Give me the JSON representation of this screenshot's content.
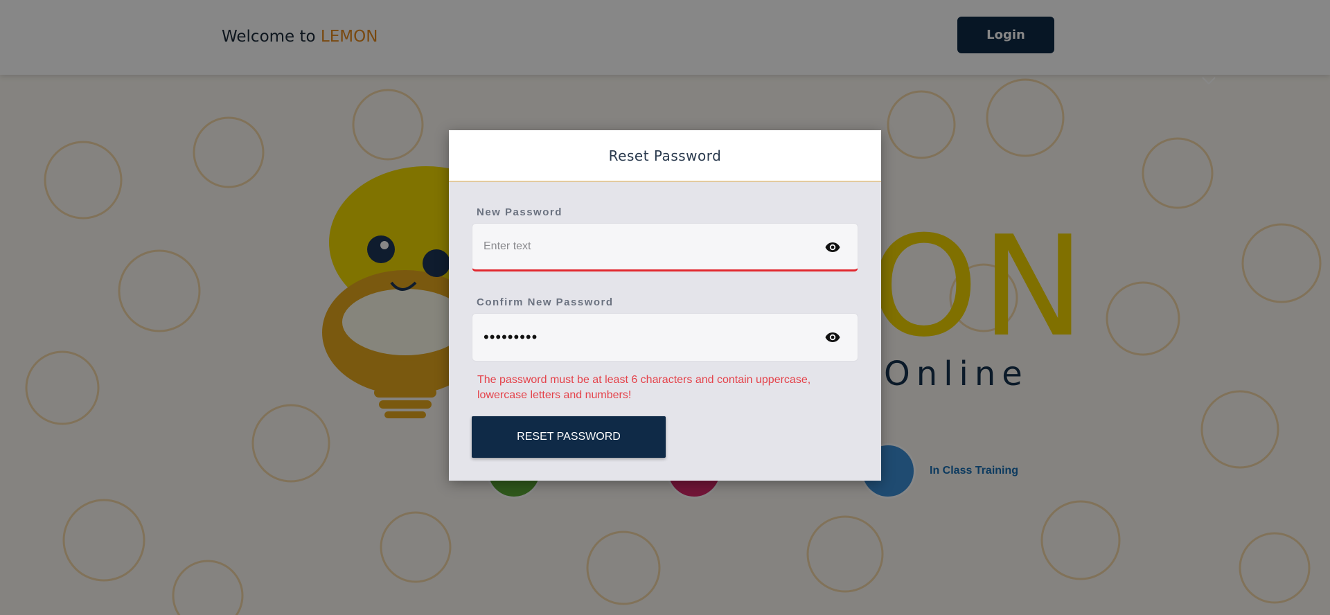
{
  "header": {
    "welcome_prefix": "Welcome to",
    "brand": "LEMON",
    "login_label": "Login"
  },
  "hero": {
    "logo_partial": "ON",
    "tagline_partial": "Online",
    "features": [
      {
        "label": ""
      },
      {
        "label": ""
      },
      {
        "label": "In Class Training"
      }
    ]
  },
  "modal": {
    "title": "Reset Password",
    "new_password": {
      "label": "New Password",
      "placeholder": "Enter text",
      "value": ""
    },
    "confirm_password": {
      "label": "Confirm New Password",
      "masked_value": "•••••••••"
    },
    "error": "The password must be at least 6 characters and contain uppercase, lowercase letters and numbers!",
    "submit_label": "RESET PASSWORD"
  },
  "colors": {
    "brand_orange": "#e58a1f",
    "navy": "#0f2a47",
    "error_red": "#e4424a",
    "divider_gold": "#e0a637",
    "logo_yellow": "#f1d400"
  },
  "icons": {
    "password_toggle": "eye-icon",
    "header_chevron": "chevron-down-icon"
  }
}
